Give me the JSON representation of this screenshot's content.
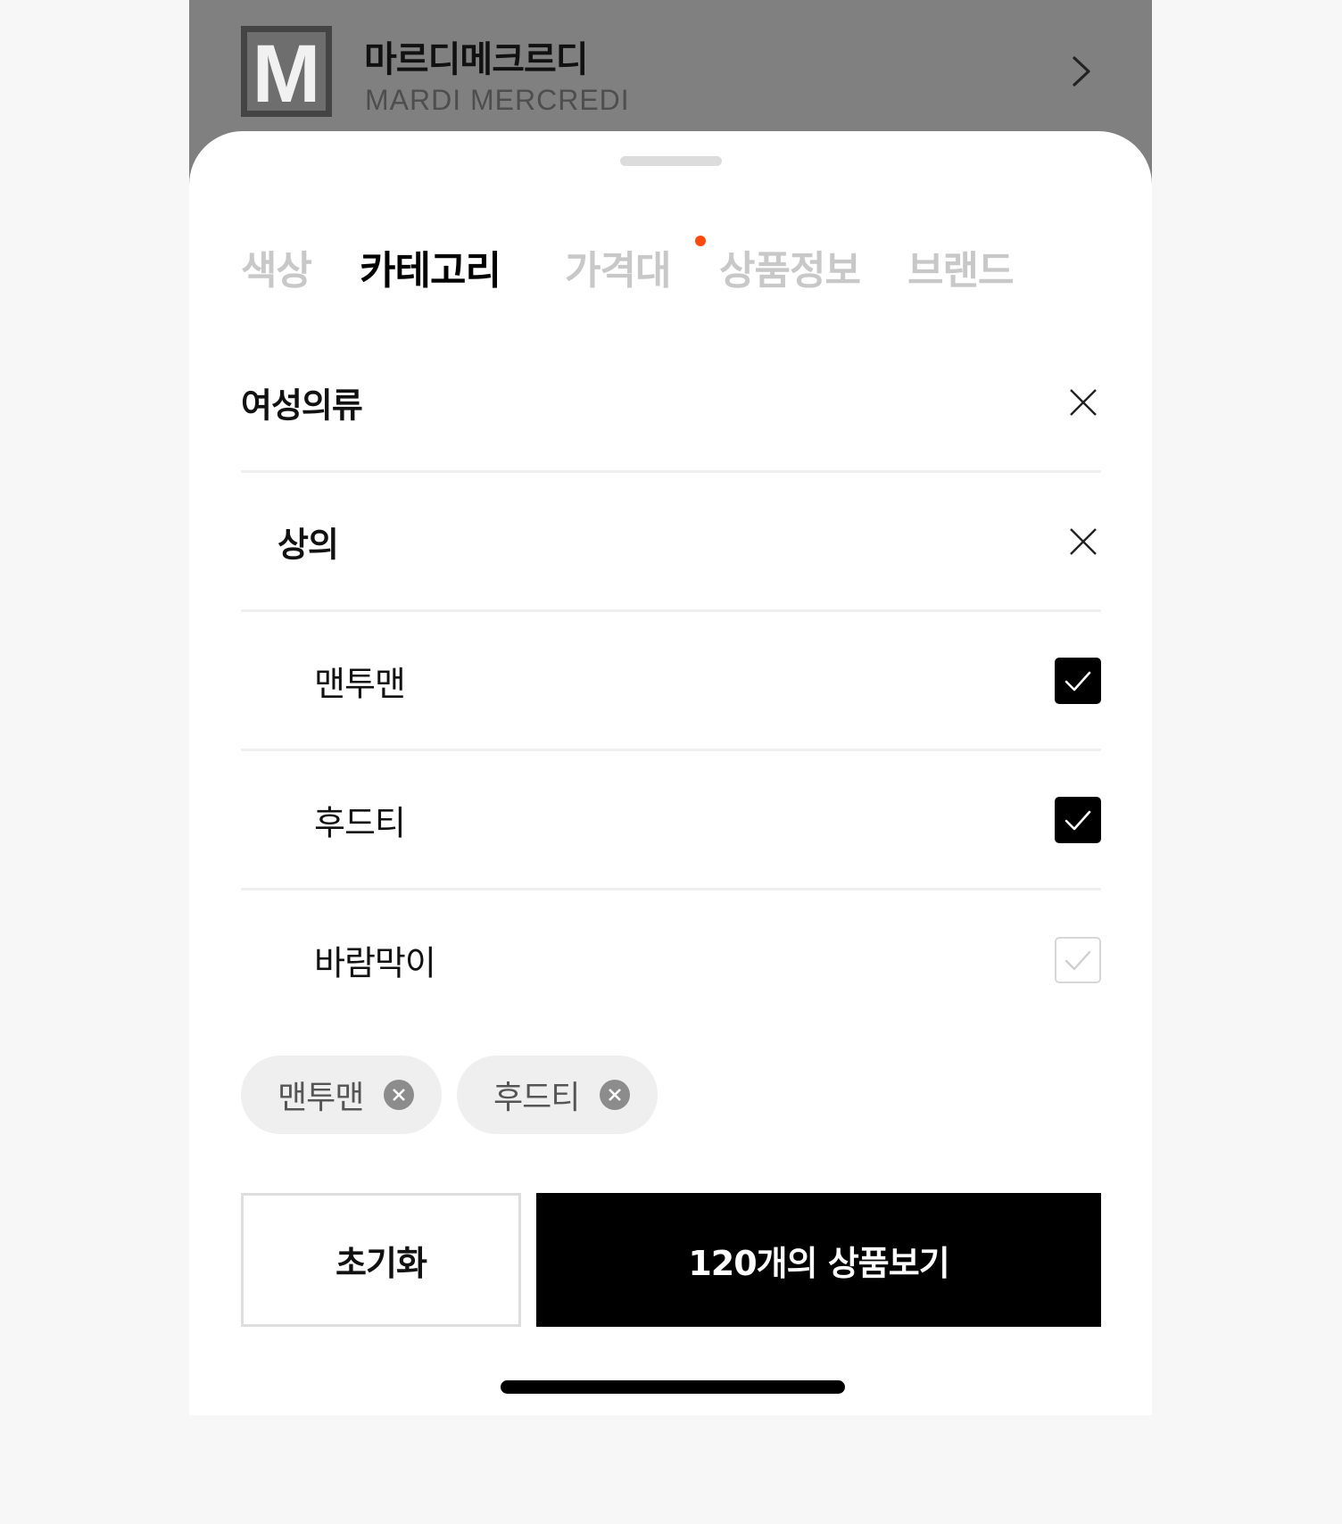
{
  "store": {
    "name": "마르디메크르디",
    "subtitle": "MARDI MERCREDI",
    "logo_letter": "M"
  },
  "filter_tabs": [
    {
      "label": "색상",
      "active": false
    },
    {
      "label": "카테고리",
      "active": true,
      "has_indicator": true
    },
    {
      "label": "가격대",
      "active": false
    },
    {
      "label": "상품정보",
      "active": false
    },
    {
      "label": "브랜드",
      "active": false
    }
  ],
  "category_path": {
    "level1": "여성의류",
    "level2": "상의"
  },
  "options": [
    {
      "label": "맨투맨",
      "checked": true
    },
    {
      "label": "후드티",
      "checked": true
    },
    {
      "label": "바람막이",
      "checked": false
    }
  ],
  "selected_chips": [
    "맨투맨",
    "후드티"
  ],
  "buttons": {
    "reset": "초기화",
    "apply": "120개의 상품보기"
  },
  "colors": {
    "accent_dot": "#ff4a0b",
    "checked_fill": "#000000",
    "inactive_tab": "#c8c8c8",
    "chip_bg": "#efefef"
  }
}
